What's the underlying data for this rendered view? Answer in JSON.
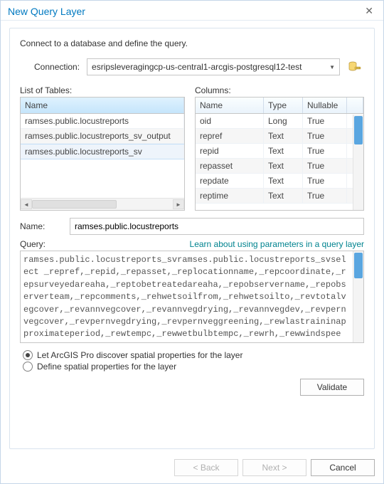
{
  "dialog": {
    "title": "New Query Layer",
    "instruction": "Connect to a database and define the query."
  },
  "connection": {
    "label": "Connection:",
    "value": "esripsleveragingcp-us-central1-arcgis-postgresql12-test"
  },
  "tables": {
    "label": "List of Tables:",
    "header": "Name",
    "rows": [
      {
        "name": "ramses.public.locustreports",
        "state": "normal"
      },
      {
        "name": "ramses.public.locustreports_sv_output",
        "state": "alt"
      },
      {
        "name": "ramses.public.locustreports_sv",
        "state": "selected"
      }
    ]
  },
  "columns": {
    "label": "Columns:",
    "headers": {
      "name": "Name",
      "type": "Type",
      "nullable": "Nullable"
    },
    "rows": [
      {
        "n": "oid",
        "t": "Long",
        "u": "True",
        "alt": false
      },
      {
        "n": "repref",
        "t": "Text",
        "u": "True",
        "alt": true
      },
      {
        "n": "repid",
        "t": "Text",
        "u": "True",
        "alt": false
      },
      {
        "n": "repasset",
        "t": "Text",
        "u": "True",
        "alt": true
      },
      {
        "n": "repdate",
        "t": "Text",
        "u": "True",
        "alt": false
      },
      {
        "n": "reptime",
        "t": "Text",
        "u": "True",
        "alt": true
      }
    ]
  },
  "name_field": {
    "label": "Name:",
    "value": "ramses.public.locustreports"
  },
  "query": {
    "label": "Query:",
    "learn_link": "Learn about using parameters in a query layer",
    "text": "ramses.public.locustreports_svramses.public.locustreports_svselect _repref,_repid,_repasset,_replocationname,_repcoordinate,_repsurveyedareaha,_reptobetreatedareaha,_repobservername,_repobserverteam,_repcomments,_rehwetsoilfrom,_rehwetsoilto,_revtotalvegcover,_revannvegcover,_revannvegdrying,_revannvegdev,_revpernvegcover,_revpernvegdrying,_revpernveggreening,_rewlastraininapproximateperiod,_rewtempc,_rewwetbulbtempc,_rewrh,_rewwindspeed,_rewsandstorm,_rlhunksitecount,_rlhsolsitecount,_rlhtrasitecount,_rlhtcositecount,_rlhtdisitecount,_rlhgresitecount,_rlhavgtuftdistance,_rlbsitecount,_rlbnumbers,_rlbavgdistance,_rlaunksitecount,_rlasolsitecount,_rlatrasitecount,_rlatcositecount,_rlatdisitecount,_rlagresitec"
  },
  "radios": {
    "opt1": "Let ArcGIS Pro discover spatial properties for the layer",
    "opt2": "Define spatial properties for the layer",
    "selected": 0
  },
  "buttons": {
    "validate": "Validate",
    "back": "< Back",
    "next": "Next >",
    "cancel": "Cancel"
  }
}
